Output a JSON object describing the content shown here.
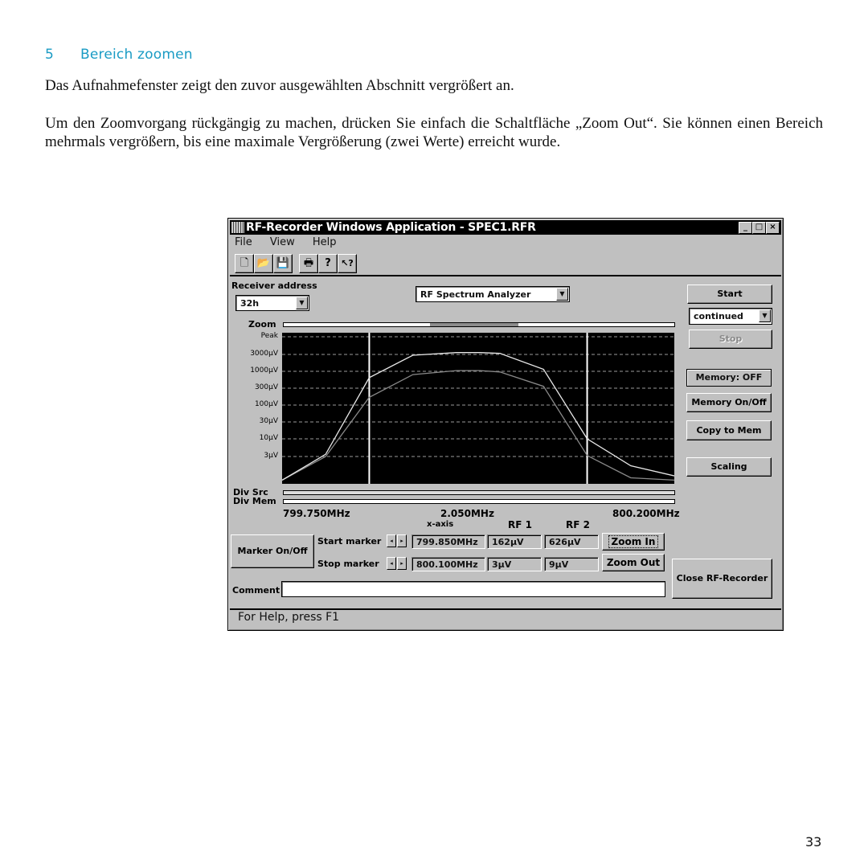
{
  "document": {
    "section_number": "5",
    "section_title": "Bereich zoomen",
    "paragraph1": "Das Aufnahmefenster zeigt den zuvor ausgewählten Abschnitt vergrößert an.",
    "paragraph2": "Um den Zoomvorgang rückgängig zu machen, drücken Sie einfach die Schaltfläche „Zoom Out“. Sie können einen Bereich mehrmals vergrößern, bis eine maximale Vergrößerung (zwei Werte) erreicht wurde.",
    "page_number": "33"
  },
  "window": {
    "title": "RF-Recorder Windows Application - SPEC1.RFR",
    "controls": {
      "minimize": "_",
      "maximize": "□",
      "close": "×"
    },
    "menu": [
      "File",
      "View",
      "Help"
    ],
    "toolbar": [
      {
        "name": "new-file-icon",
        "glyph": "🗋"
      },
      {
        "name": "open-folder-icon",
        "glyph": "📂"
      },
      {
        "name": "save-disk-icon",
        "glyph": "💾"
      },
      {
        "name": "print-icon",
        "glyph": "🖶"
      },
      {
        "name": "help-icon",
        "glyph": "?"
      },
      {
        "name": "context-help-icon",
        "glyph": "↖?"
      }
    ],
    "receiver_address_label": "Receiver address",
    "receiver_address_value": "32h",
    "mode_select_value": "RF Spectrum Analyzer",
    "dropdown_arrow": "▼",
    "zoom_label": "Zoom",
    "zoom_thumb": {
      "start_fraction": 0.375,
      "end_fraction": 0.6
    },
    "start_button": "Start",
    "run_mode_value": "continued",
    "stop_button": "Stop",
    "memory_status": "Memory: OFF",
    "memory_toggle_button": "Memory On/Off",
    "copy_to_mem_button": "Copy to Mem",
    "scaling_button": "Scaling",
    "div_src_label": "Div Src",
    "div_mem_label": "Div Mem",
    "x_left_label": "799.750MHz",
    "x_span_label": "2.050MHz",
    "x_right_label": "800.200MHz",
    "col_x_axis": "x-axis",
    "col_rf1": "RF 1",
    "col_rf2": "RF 2",
    "marker_toggle_button": "Marker On/Off",
    "start_marker_label": "Start marker",
    "stop_marker_label": "Stop marker",
    "spin_left": "◂",
    "spin_right": "▸",
    "start_marker": {
      "x": "799.850MHz",
      "rf1": "162µV",
      "rf2": "626µV"
    },
    "stop_marker": {
      "x": "800.100MHz",
      "rf1": "3µV",
      "rf2": "9µV"
    },
    "zoom_in_button": "Zoom In",
    "zoom_out_button": "Zoom Out",
    "comment_label": "Comment",
    "comment_value": "",
    "close_button": "Close RF-Recorder",
    "status_text": "For Help, press F1"
  },
  "chart_data": {
    "type": "line",
    "title": "",
    "xlabel": "x-axis (MHz)",
    "ylabel": "",
    "y_scale": "log",
    "y_ticks": [
      "Peak",
      "3000µV",
      "1000µV",
      "300µV",
      "100µV",
      "30µV",
      "10µV",
      "3µV"
    ],
    "y_tick_values_uV": [
      10000,
      3000,
      1000,
      300,
      100,
      30,
      10,
      3
    ],
    "xlim": [
      799.75,
      800.2
    ],
    "ylim_uV": [
      0.5,
      10000
    ],
    "grid": true,
    "markers_MHz": [
      799.85,
      800.1
    ],
    "x": [
      799.75,
      799.8,
      799.85,
      799.9,
      799.95,
      799.977,
      800.0,
      800.05,
      800.1,
      800.15,
      800.2
    ],
    "series": [
      {
        "name": "trace-bright",
        "color": "#e8e8e8",
        "values": [
          0.6,
          3.5,
          650,
          3000,
          3600,
          3600,
          3400,
          1150,
          10,
          1.6,
          0.8
        ]
      },
      {
        "name": "trace-dim",
        "color": "#8a8a8a",
        "values": [
          0.6,
          3.0,
          170,
          800,
          1050,
          1050,
          960,
          360,
          3.2,
          0.7,
          0.6
        ]
      }
    ]
  }
}
